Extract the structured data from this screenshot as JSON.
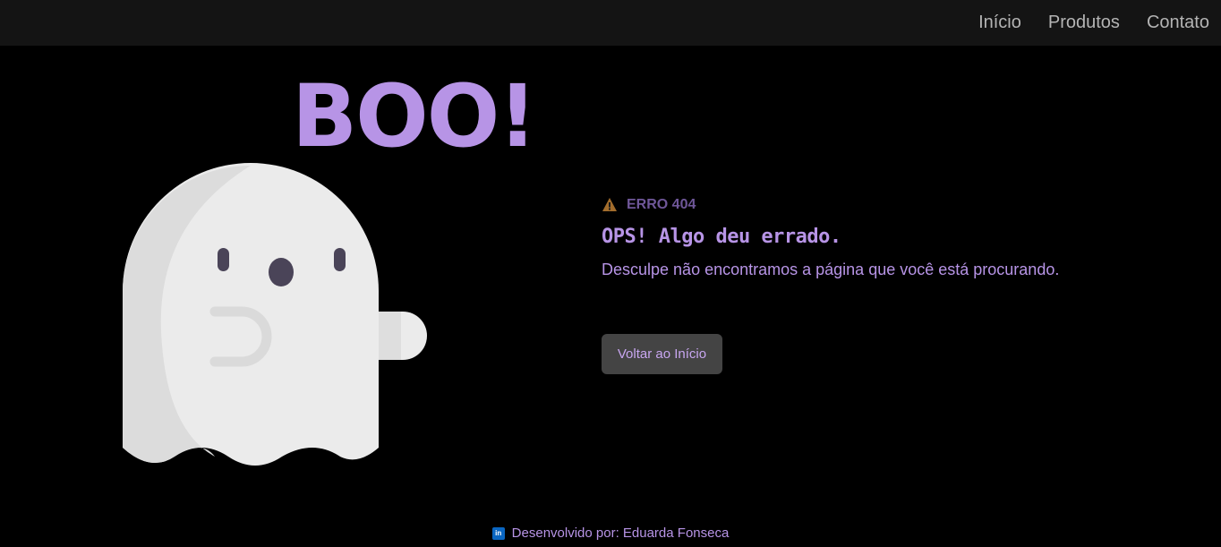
{
  "nav": {
    "links": [
      "Início",
      "Produtos",
      "Contato"
    ]
  },
  "illustration": {
    "boo_text": "BOO!",
    "ghost_color": "#ebebeb",
    "accent_color": "#b794e6"
  },
  "error": {
    "icon": "warning-icon",
    "code": "ERRO 404",
    "headline": "OPS! Algo deu errado.",
    "description": "Desculpe não encontramos a página que você está procurando.",
    "button_label": "Voltar ao Início"
  },
  "footer": {
    "icon": "linkedin-icon",
    "text": "Desenvolvido por: Eduarda Fonseca"
  }
}
